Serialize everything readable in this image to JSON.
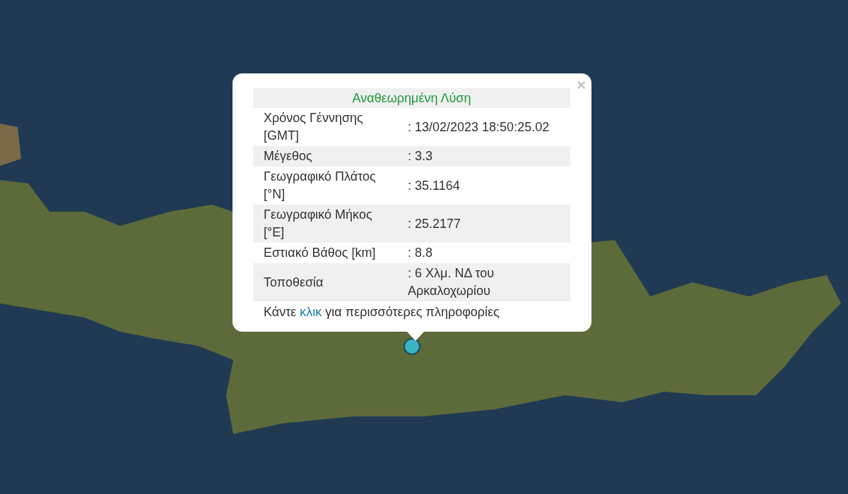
{
  "popup": {
    "title": "Αναθεωρημένη Λύση",
    "rows": [
      {
        "label": "Χρόνος Γέννησης [GMT]",
        "value": ": 13/02/2023 18:50:25.02"
      },
      {
        "label": "Μέγεθος",
        "value": ": 3.3"
      },
      {
        "label": "Γεωγραφικό Πλάτος [°N]",
        "value": ": 35.1164"
      },
      {
        "label": "Γεωγραφικό Μήκος [°E]",
        "value": ": 25.2177"
      },
      {
        "label": "Εστιακό Βάθος [km]",
        "value": ": 8.8"
      },
      {
        "label": "Τοποθεσία",
        "value": ": 6 Χλμ. ΝΔ του Αρκαλοχωρίου"
      }
    ],
    "footer": {
      "before": "Κάντε ",
      "link": "κλικ",
      "after": " για περισσότερες πληροφορίες"
    },
    "close": "×"
  }
}
